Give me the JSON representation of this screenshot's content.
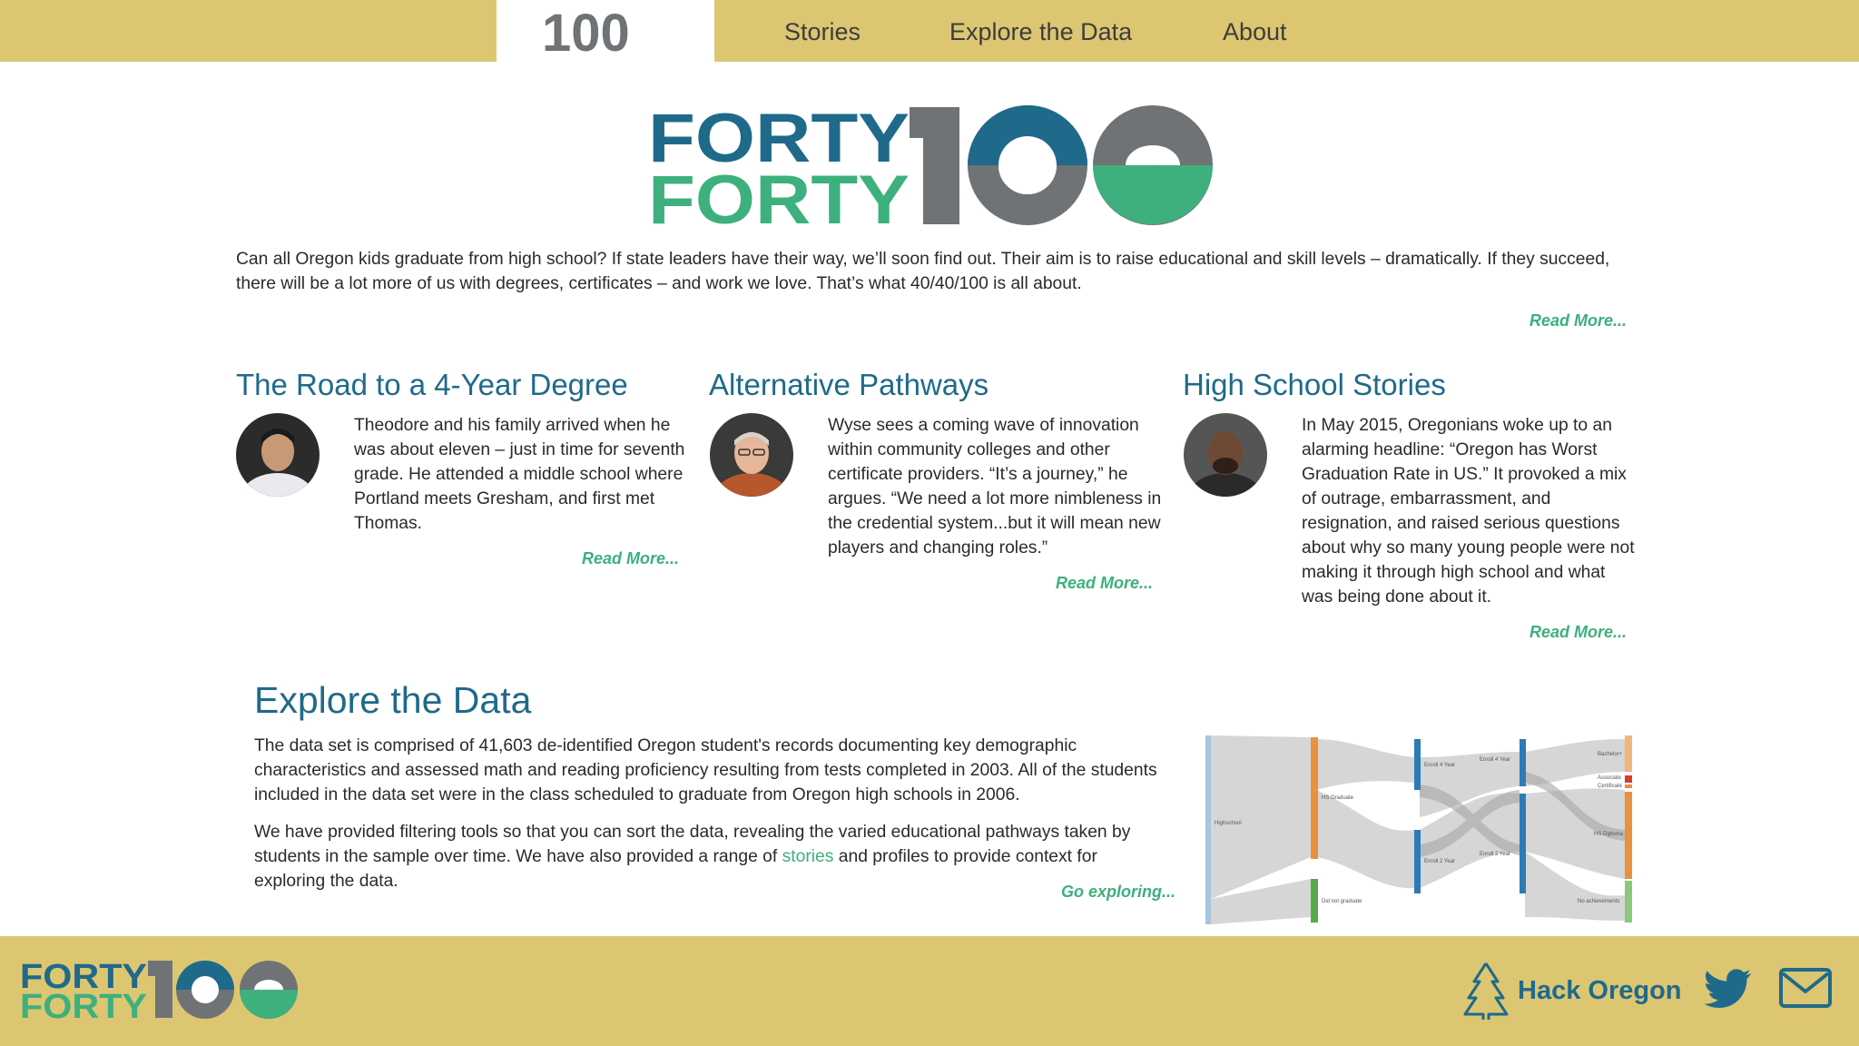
{
  "nav": {
    "logo_text": "100",
    "items": [
      "Stories",
      "Explore the Data",
      "About"
    ]
  },
  "hero": {
    "logo_line1": "FORTY",
    "logo_line2": "FORTY",
    "intro": "Can all Oregon kids graduate from high school? If state leaders have their way, we’ll soon find out. Their aim is to raise educational and skill levels – dramatically. If they succeed, there will be a lot more of us with degrees, certificates – and work we love. That’s what 40/40/100 is all about.",
    "read_more": "Read More..."
  },
  "stories": [
    {
      "title": "The Road to a 4-Year Degree",
      "text": "Theodore and his family arrived when he was about eleven – just in time for seventh grade. He attended a middle school where Portland meets Gresham, and first met Thomas.",
      "read_more": "Read More..."
    },
    {
      "title": "Alternative Pathways",
      "text": "Wyse sees a coming wave of innovation within community colleges and other certificate providers. “It’s a journey,” he argues. “We need a lot more nimbleness in the credential system...but it will mean new players and changing roles.”",
      "read_more": "Read More..."
    },
    {
      "title": "High School Stories",
      "text": "In May 2015, Oregonians woke up to an alarming headline: “Oregon has Worst Graduation Rate in US.” It provoked a mix of outrage, embarrassment, and resignation, and raised serious questions about why so many young people were not making it through high school and what was being done about it.",
      "read_more": "Read More..."
    }
  ],
  "explore": {
    "title": "Explore the Data",
    "p1": "The data set is comprised of 41,603 de-identified Oregon student's records documenting key demographic characteristics and assessed math and reading proficiency resulting from tests completed in 2003. All of the students included in the data set were in the class scheduled to graduate from Oregon high schools in 2006.",
    "p2_before": "We have provided filtering tools so that you can sort the data, revealing the varied educational pathways taken by students in the sample over time. We have also provided a range of ",
    "p2_link": "stories",
    "p2_after": " and profiles to provide context for exploring the data.",
    "go": "Go exploring...",
    "sankey_labels": {
      "highschool": "Highschool",
      "hs_graduate": "HS Graduate",
      "did_not_graduate": "Did not graduate",
      "enroll_4yr_a": "Enroll 4 Year",
      "enroll_2yr_a": "Enroll 2 Year",
      "enroll_4yr_b": "Enroll 4 Year",
      "enroll_2yr_b": "Enroll 2 Year",
      "bachelor": "Bachelor+",
      "associate": "Associate",
      "certificate": "Certificate",
      "hs_diploma": "HS Diploma",
      "no_achievements": "No achievements"
    }
  },
  "footer": {
    "logo_line1": "FORTY",
    "logo_line2": "FORTY",
    "hack": "Hack Oregon"
  },
  "colors": {
    "gold": "#dcc672",
    "teal": "#1f6a8a",
    "green": "#3db07e",
    "gray": "#6f7375"
  }
}
